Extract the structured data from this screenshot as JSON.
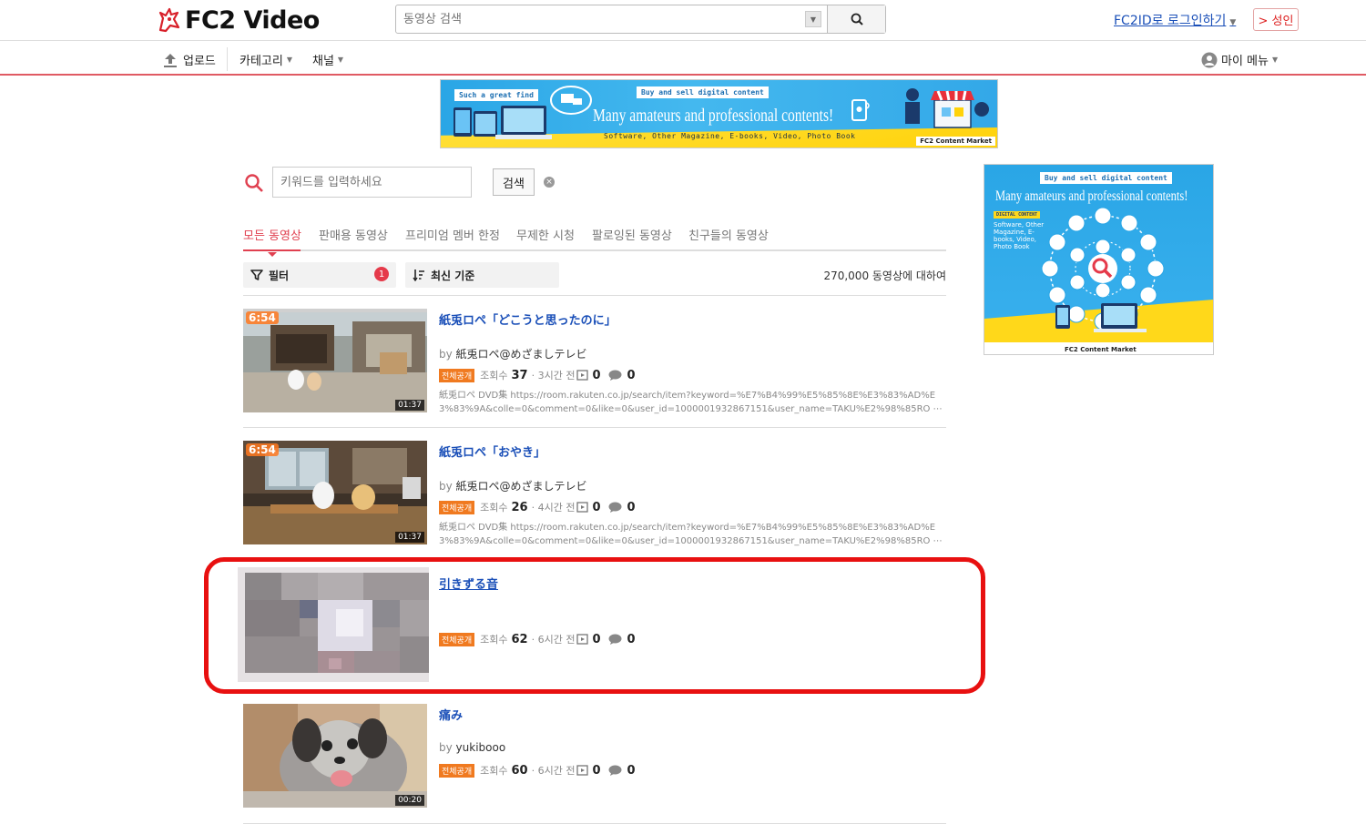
{
  "header": {
    "logo_text": "FC2 Video",
    "search_placeholder": "동영상 검색",
    "login_label": "FC2ID로 로그인하기",
    "adult_label": "> 성인"
  },
  "nav": {
    "upload": "업로드",
    "category": "카테고리",
    "channel": "채널",
    "my_menu": "마이 메뉴"
  },
  "ad_top": {
    "tag1": "Such a great find",
    "tag2": "Buy and sell digital content",
    "title": "Many amateurs and professional contents!",
    "subtitle": "Software, Other Magazine, E-books, Video, Photo Book",
    "brand": "FC2 Content Market"
  },
  "ad_side": {
    "tag": "Buy and sell digital content",
    "title": "Many amateurs and professional contents!",
    "label": "DIGITAL CONTENT",
    "subtitle": "Software, Other Magazine, E-books, Video, Photo Book",
    "brand": "FC2 Content Market"
  },
  "keyword": {
    "placeholder": "키워드를 입력하세요",
    "button": "검색"
  },
  "tabs": [
    "모든 동영상",
    "판매용 동영상",
    "프리미엄 멤버 한정",
    "무제한 시청",
    "팔로잉된 동영상",
    "친구들의 동영상"
  ],
  "filter": {
    "filter_label": "필터",
    "filter_count": "1",
    "sort_label": "최신 기준",
    "result_count": "270,000 동영상에 대하여"
  },
  "videos": [
    {
      "title": "紙兎ロペ「どこうと思ったのに」",
      "by_label": "by",
      "author": "紙兎ロペ@めざましテレビ",
      "public_label": "전체공개",
      "views_label": "조회수",
      "views": "37",
      "time": "· 3시간 전",
      "clips": "0",
      "comments": "0",
      "duration": "01:37",
      "badge": "6:54",
      "desc": "紙兎ロペ DVD集 https://room.rakuten.co.jp/search/item?keyword=%E7%B4%99%E5%85%8E%E3%83%AD%E3%83%9A&colle=0&comment=0&like=0&user_id=1000001932867151&user_name=TAKU%E2%98%85RO ⋯"
    },
    {
      "title": "紙兎ロペ「おやき」",
      "by_label": "by",
      "author": "紙兎ロペ@めざましテレビ",
      "public_label": "전체공개",
      "views_label": "조회수",
      "views": "26",
      "time": "· 4시간 전",
      "clips": "0",
      "comments": "0",
      "duration": "01:37",
      "badge": "6:54",
      "desc": "紙兎ロペ DVD集 https://room.rakuten.co.jp/search/item?keyword=%E7%B4%99%E5%85%8E%E3%83%AD%E3%83%9A&colle=0&comment=0&like=0&user_id=1000001932867151&user_name=TAKU%E2%98%85RO ⋯"
    },
    {
      "title": "引きずる音",
      "public_label": "전체공개",
      "views_label": "조회수",
      "views": "62",
      "time": "· 6시간 전",
      "clips": "0",
      "comments": "0"
    },
    {
      "title": "痛み",
      "by_label": "by",
      "author": "yukibooo",
      "public_label": "전체공개",
      "views_label": "조회수",
      "views": "60",
      "time": "· 6시간 전",
      "clips": "0",
      "comments": "0",
      "duration": "00:20"
    }
  ],
  "icons": {
    "logo": "fc2-unicorn-icon",
    "search": "magnifier-icon",
    "upload": "upload-arrow-icon",
    "user": "user-avatar-icon",
    "filter": "funnel-icon",
    "sort": "sort-icon",
    "clip": "clip-icon",
    "comment": "comment-bubble-icon",
    "clear": "clear-circle-icon"
  },
  "colors": {
    "accent": "#e04050",
    "link": "#1a4fb8",
    "public_badge": "#f07a20",
    "highlight": "#e81010"
  }
}
